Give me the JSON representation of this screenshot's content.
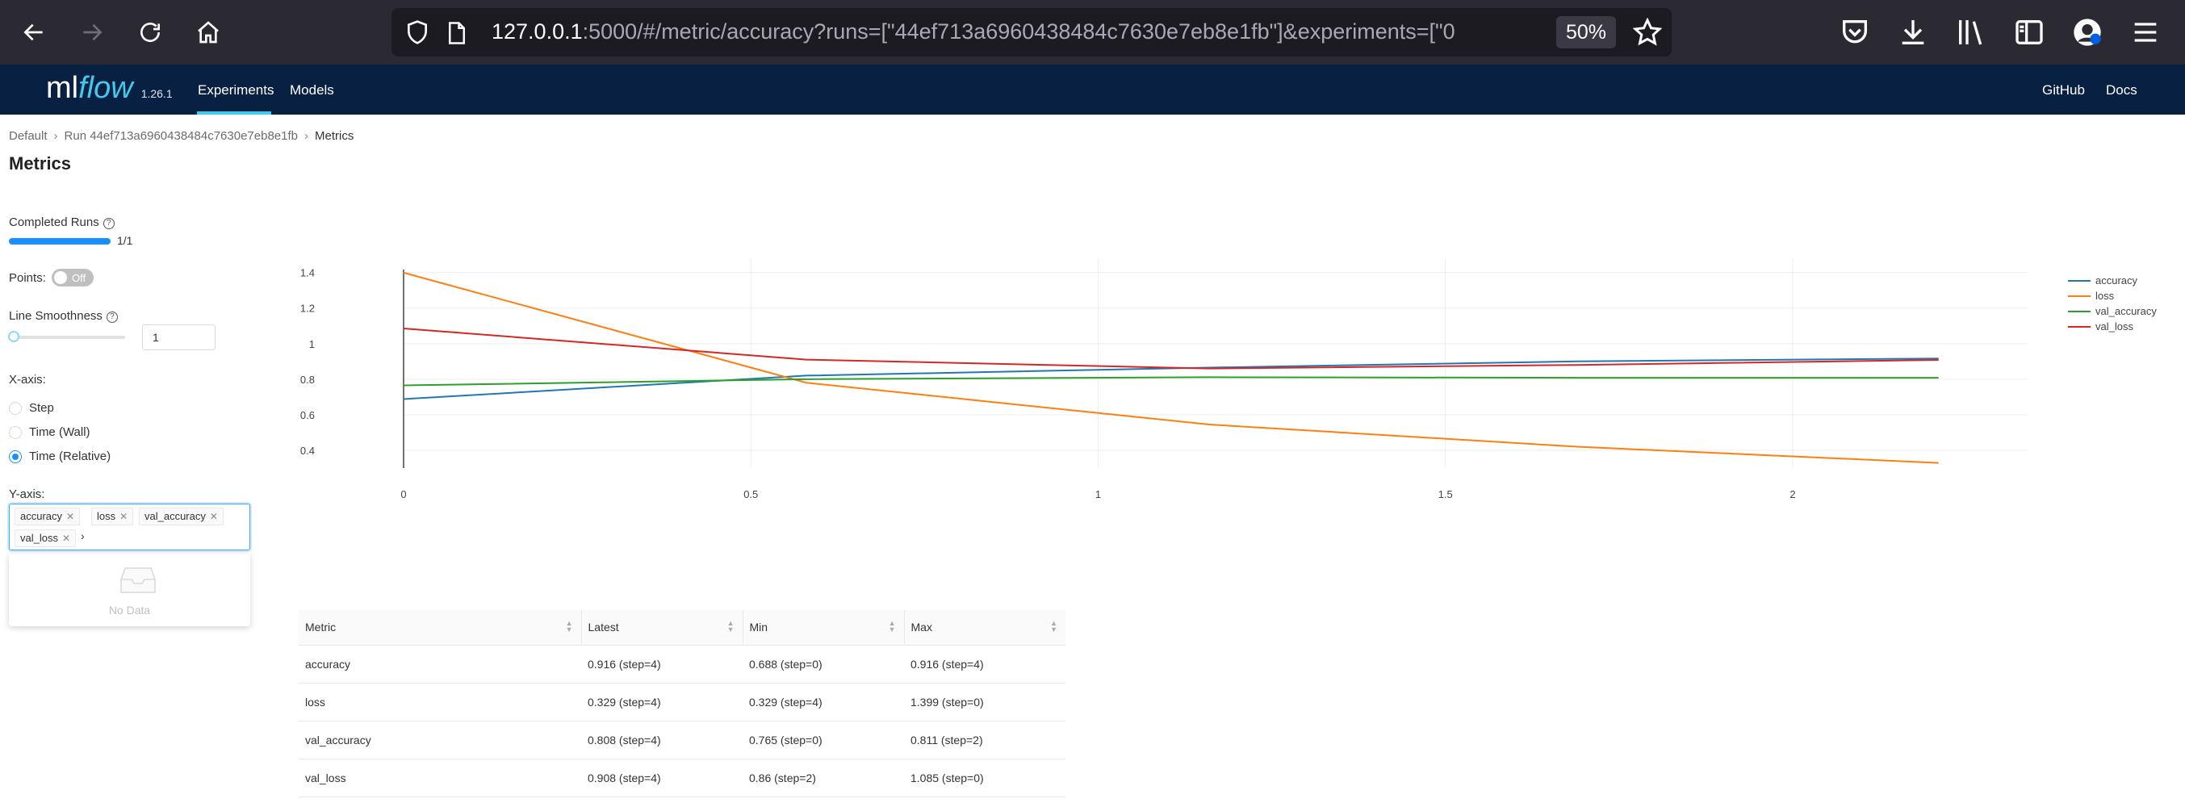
{
  "browser": {
    "url_host": "127.0.0.1",
    "url_rest": ":5000/#/metric/accuracy?runs=[\"44ef713a6960438484c7630e7eb8e1fb\"]&experiments=[\"0",
    "zoom": "50%"
  },
  "header": {
    "brand_ml": "ml",
    "brand_flow": "flow",
    "version": "1.26.1",
    "nav": {
      "experiments": "Experiments",
      "models": "Models"
    },
    "right": {
      "github": "GitHub",
      "docs": "Docs"
    },
    "accent_color": "#43c9ed",
    "bg_color": "#082142"
  },
  "breadcrumb": {
    "items": [
      "Default",
      "Run 44ef713a6960438484c7630e7eb8e1fb",
      "Metrics"
    ]
  },
  "page_title": "Metrics",
  "controls": {
    "completed_runs_label": "Completed Runs",
    "completed_runs_fraction": 1.0,
    "completed_runs_text": "1/1",
    "points_label": "Points:",
    "points_toggle": "Off",
    "smoothness_label": "Line Smoothness",
    "smoothness_value": "1",
    "xaxis_label": "X-axis:",
    "xaxis_options": [
      "Step",
      "Time (Wall)",
      "Time (Relative)"
    ],
    "xaxis_selected": "Time (Relative)",
    "yaxis_label": "Y-axis:",
    "yaxis_tags": [
      "accuracy",
      "loss",
      "val_accuracy",
      "val_loss"
    ],
    "dropdown_empty": "No Data"
  },
  "chart_data": {
    "type": "line",
    "title": "",
    "xlabel": "",
    "ylabel": "",
    "xlim": [
      0,
      2.2
    ],
    "ylim": [
      0.3,
      1.48
    ],
    "xticks": [
      0,
      0.5,
      1,
      1.5,
      2
    ],
    "xtick_labels": [
      "0",
      "0.5",
      "1",
      "1.5",
      "2"
    ],
    "yticks": [
      0.4,
      0.6,
      0.8,
      1.0,
      1.2,
      1.4
    ],
    "ytick_labels": [
      "0.4",
      "0.6",
      "0.8",
      "1",
      "1.2",
      "1.4"
    ],
    "grid": true,
    "legend_position": "top-right",
    "series": [
      {
        "name": "accuracy",
        "color": "#1f77b4",
        "x": [
          0,
          0.58,
          1.16,
          1.69,
          2.21
        ],
        "y": [
          0.688,
          0.82,
          0.865,
          0.9,
          0.916
        ]
      },
      {
        "name": "loss",
        "color": "#ff7f0e",
        "x": [
          0,
          0.58,
          1.16,
          1.69,
          2.21
        ],
        "y": [
          1.399,
          0.78,
          0.545,
          0.42,
          0.329
        ]
      },
      {
        "name": "val_accuracy",
        "color": "#2ca02c",
        "x": [
          0,
          0.58,
          1.16,
          1.69,
          2.21
        ],
        "y": [
          0.765,
          0.8,
          0.811,
          0.808,
          0.808
        ]
      },
      {
        "name": "val_loss",
        "color": "#d62728",
        "x": [
          0,
          0.58,
          1.16,
          1.69,
          2.21
        ],
        "y": [
          1.085,
          0.91,
          0.86,
          0.88,
          0.908
        ]
      }
    ]
  },
  "table": {
    "columns": [
      "Metric",
      "Latest",
      "Min",
      "Max"
    ],
    "rows": [
      [
        "accuracy",
        "0.916 (step=4)",
        "0.688 (step=0)",
        "0.916 (step=4)"
      ],
      [
        "loss",
        "0.329 (step=4)",
        "0.329 (step=4)",
        "1.399 (step=0)"
      ],
      [
        "val_accuracy",
        "0.808 (step=4)",
        "0.765 (step=0)",
        "0.811 (step=2)"
      ],
      [
        "val_loss",
        "0.908 (step=4)",
        "0.86 (step=2)",
        "1.085 (step=0)"
      ]
    ]
  }
}
